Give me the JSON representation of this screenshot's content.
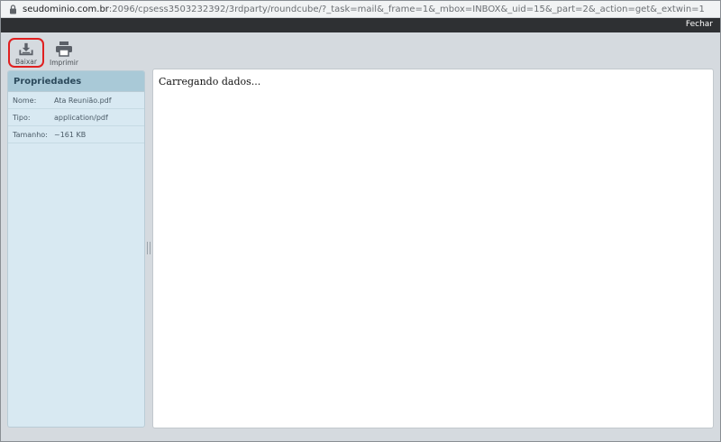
{
  "browser": {
    "url_host": "seudominio.com.br",
    "url_path": ":2096/cpsess3503232392/3rdparty/roundcube/?_task=mail&_frame=1&_mbox=INBOX&_uid=15&_part=2&_action=get&_extwin=1"
  },
  "topbar": {
    "close_label": "Fechar"
  },
  "toolbar": {
    "download_label": "Baixar",
    "print_label": "Imprimir",
    "highlight_color": "#e02020"
  },
  "sidebar": {
    "title": "Propriedades",
    "rows": [
      {
        "label": "Nome:",
        "value": "Ata Reunião.pdf"
      },
      {
        "label": "Tipo:",
        "value": "application/pdf"
      },
      {
        "label": "Tamanho:",
        "value": "~161 KB"
      }
    ]
  },
  "content": {
    "loading_text": "Carregando dados..."
  }
}
